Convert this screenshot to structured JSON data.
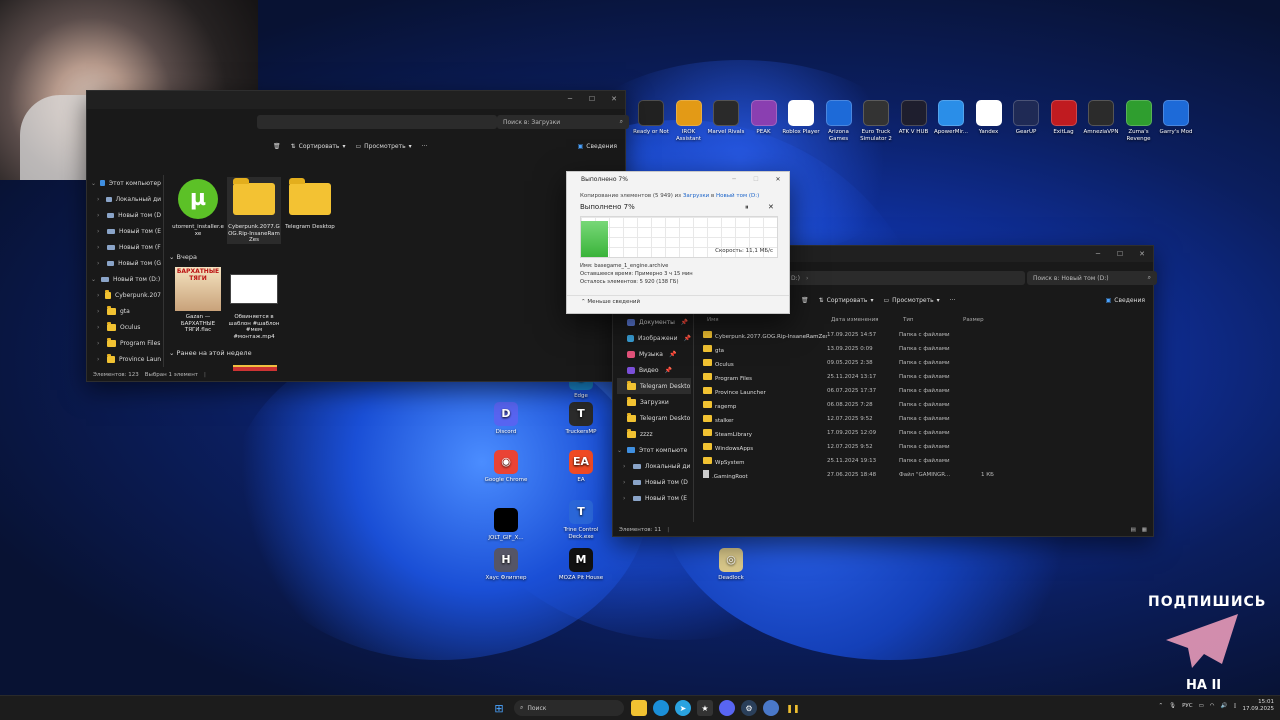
{
  "colors": {
    "accent": "#3f8fe0",
    "folder": "#f1c232",
    "progress": "#3ab33a",
    "link": "#1a63c9"
  },
  "explorer_left": {
    "search_placeholder": "Поиск в: Загрузки",
    "toolbar": {
      "sort": "Сортировать",
      "view": "Просмотреть",
      "more": "···",
      "details": "Сведения"
    },
    "nav": [
      {
        "label": "Этот компьютер",
        "icon": "pc-icon",
        "level": 0
      },
      {
        "label": "Локальный ди",
        "icon": "drive-icon",
        "level": 1
      },
      {
        "label": "Новый том (D",
        "icon": "drive-icon",
        "level": 1
      },
      {
        "label": "Новый том (E",
        "icon": "drive-icon",
        "level": 1
      },
      {
        "label": "Новый том (F",
        "icon": "drive-icon",
        "level": 1
      },
      {
        "label": "Новый том (G",
        "icon": "drive-icon",
        "level": 1
      },
      {
        "label": "Новый том (D:)",
        "icon": "drive-icon",
        "level": 0
      },
      {
        "label": "Cyberpunk.207",
        "icon": "folder-icon",
        "level": 1
      },
      {
        "label": "gta",
        "icon": "folder-icon",
        "level": 1
      },
      {
        "label": "Oculus",
        "icon": "folder-icon",
        "level": 1
      },
      {
        "label": "Program Files",
        "icon": "folder-icon",
        "level": 1
      },
      {
        "label": "Province Laun",
        "icon": "folder-icon",
        "level": 1
      }
    ],
    "files_top": [
      {
        "name": "utorrent_installer.exe",
        "icon": "utorrent-icon"
      },
      {
        "name": "Cyberpunk.2077.GOG.Rip-InsaneRamZes",
        "icon": "folder-icon"
      },
      {
        "name": "Telegram Desktop",
        "icon": "folder-icon"
      }
    ],
    "section_yesterday": "Вчера",
    "files_yesterday": [
      {
        "name": "Gazan — БАРХАТНЫЕ ТЯГИ.flac",
        "thumb_text": "БАРХАТНЫЕ ТЯГИ"
      },
      {
        "name": "Обвиняется в шаблон #шаблон #мем #монтаж.mp4",
        "thumb_text": ""
      }
    ],
    "section_week": "Ранее на этой неделе",
    "status": {
      "count": "Элементов: 123",
      "selected": "Выбран 1 элемент"
    }
  },
  "explorer_right": {
    "address": "D:)",
    "search_placeholder": "Поиск в: Новый том (D:)",
    "toolbar": {
      "sort": "Сортировать",
      "view": "Просмотреть",
      "more": "···",
      "details": "Сведения"
    },
    "nav": [
      {
        "label": "Документы",
        "icon": "documents-icon"
      },
      {
        "label": "Изображени",
        "icon": "pictures-icon"
      },
      {
        "label": "Музыка",
        "icon": "music-icon"
      },
      {
        "label": "Видео",
        "icon": "video-icon"
      },
      {
        "label": "Telegram Deskto",
        "icon": "folder-icon"
      },
      {
        "label": "Загрузки",
        "icon": "folder-icon"
      },
      {
        "label": "Telegram Deskto",
        "icon": "folder-icon"
      },
      {
        "label": "zzzz",
        "icon": "folder-icon"
      },
      {
        "label": "Этот компьюте",
        "icon": "pc-icon"
      },
      {
        "label": "Локальный ди",
        "icon": "drive-icon"
      },
      {
        "label": "Новый том (D",
        "icon": "drive-icon"
      },
      {
        "label": "Новый том (E",
        "icon": "drive-icon"
      }
    ],
    "columns": {
      "name": "Имя",
      "date": "Дата изменения",
      "type": "Тип",
      "size": "Размер"
    },
    "rows": [
      {
        "name": "Cyberpunk.2077.GOG.Rip-InsaneRamZes",
        "date": "17.09.2025 14:57",
        "type": "Папка с файлами",
        "size": ""
      },
      {
        "name": "gta",
        "date": "13.09.2025 0:09",
        "type": "Папка с файлами",
        "size": ""
      },
      {
        "name": "Oculus",
        "date": "09.05.2025 2:38",
        "type": "Папка с файлами",
        "size": ""
      },
      {
        "name": "Program Files",
        "date": "25.11.2024 13:17",
        "type": "Папка с файлами",
        "size": ""
      },
      {
        "name": "Province Launcher",
        "date": "06.07.2025 17:37",
        "type": "Папка с файлами",
        "size": ""
      },
      {
        "name": "ragemp",
        "date": "06.08.2025 7:28",
        "type": "Папка с файлами",
        "size": ""
      },
      {
        "name": "stalker",
        "date": "12.07.2025 9:52",
        "type": "Папка с файлами",
        "size": ""
      },
      {
        "name": "SteamLibrary",
        "date": "17.09.2025 12:09",
        "type": "Папка с файлами",
        "size": ""
      },
      {
        "name": "WindowsApps",
        "date": "12.07.2025 9:52",
        "type": "Папка с файлами",
        "size": ""
      },
      {
        "name": "WpSystem",
        "date": "25.11.2024 19:13",
        "type": "Папка с файлами",
        "size": ""
      },
      {
        "name": ".GamingRoot",
        "date": "27.06.2025 18:48",
        "type": "Файл \"GAMINGR...",
        "size": "1 КБ"
      }
    ],
    "status": "Элементов: 11"
  },
  "copy_dialog": {
    "title": "Выполнено 7%",
    "line1_prefix": "Копирование элементов (5 949) из ",
    "from": "Загрузки",
    "mid": " в ",
    "to": "Новый том (D:)",
    "heading": "Выполнено 7%",
    "progress": 0.07,
    "speed": "Скорость: 11,1 МБ/с",
    "name_line": "Имя: basegame_1_engine.archive",
    "time_line": "Оставшееся время: Примерно 3 ч 15 мин",
    "items_line": "Осталось элементов: 5 920 (138 ГБ)",
    "less": "Меньше сведений"
  },
  "desktop_top": [
    {
      "label": "Ready or Not",
      "color": "#222"
    },
    {
      "label": "IROK Assistant",
      "color": "#e39a16"
    },
    {
      "label": "Marvel Rivals",
      "color": "#2a2a2a"
    },
    {
      "label": "PEAK",
      "color": "#8a3fb1"
    },
    {
      "label": "Roblox Player",
      "color": "#ffffff"
    },
    {
      "label": "Arizona Games",
      "color": "#1d6ad8"
    },
    {
      "label": "Euro Truck Simulator 2",
      "color": "#333"
    },
    {
      "label": "ATK V HUB",
      "color": "#1e1e2e"
    },
    {
      "label": "ApowerMir...",
      "color": "#2a8ee8"
    },
    {
      "label": "Yandex",
      "color": "#ffffff"
    },
    {
      "label": "GearUP",
      "color": "#1f2a55"
    },
    {
      "label": "ExitLag",
      "color": "#c01b20"
    },
    {
      "label": "AmneziaVPN",
      "color": "#2b2b2b"
    },
    {
      "label": "Zuma's Revenge",
      "color": "#2f9e2f"
    },
    {
      "label": "Garry's Mod",
      "color": "#1d6ad8"
    }
  ],
  "desktop_mid": [
    {
      "label": "Edge",
      "glyph": "e",
      "color": "#1b8fd8"
    },
    {
      "label": "Discord",
      "glyph": "D",
      "color": "#5865f2"
    },
    {
      "label": "TruckersMP",
      "glyph": "T",
      "color": "#2b2b2b"
    },
    {
      "label": "Google Chrome",
      "glyph": "◉",
      "color": "#ea4335"
    },
    {
      "label": "EA",
      "glyph": "EA",
      "color": "#f04a24"
    },
    {
      "label": "JOLT_GIF_X...",
      "glyph": "",
      "color": "#000"
    },
    {
      "label": "Trine Control Deck.exe",
      "glyph": "T",
      "color": "#2a66d8"
    },
    {
      "label": "Хаус Флиппер",
      "glyph": "H",
      "color": "#556"
    },
    {
      "label": "MOZA Pit House",
      "glyph": "M",
      "color": "#111"
    },
    {
      "label": "Deadlock",
      "glyph": "◎",
      "color": "#d9c88a"
    }
  ],
  "overlay": {
    "subscribe": "ПОДПИШИСЬ",
    "on": "НА II"
  },
  "taskbar": {
    "search": "Поиск",
    "lang": "РУС",
    "time": "15:01",
    "date": "17.09.2025"
  }
}
